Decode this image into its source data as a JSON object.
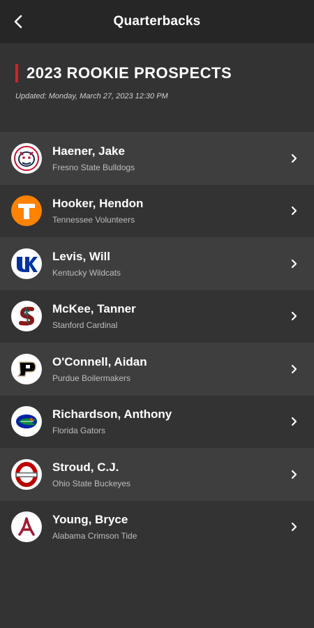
{
  "header": {
    "title": "Quarterbacks"
  },
  "section": {
    "title": "2023 ROOKIE PROSPECTS",
    "updated": "Updated: Monday, March 27, 2023 12:30 PM",
    "accent_color": "#d6202a"
  },
  "players": [
    {
      "name": "Haener, Jake",
      "team": "Fresno State Bulldogs",
      "logo_icon": "fresno-state-bulldog-logo"
    },
    {
      "name": "Hooker, Hendon",
      "team": "Tennessee Volunteers",
      "logo_icon": "tennessee-t-logo"
    },
    {
      "name": "Levis, Will",
      "team": "Kentucky Wildcats",
      "logo_icon": "kentucky-uk-logo"
    },
    {
      "name": "McKee, Tanner",
      "team": "Stanford Cardinal",
      "logo_icon": "stanford-s-tree-logo"
    },
    {
      "name": "O'Connell, Aidan",
      "team": "Purdue Boilermakers",
      "logo_icon": "purdue-p-logo"
    },
    {
      "name": "Richardson, Anthony",
      "team": "Florida Gators",
      "logo_icon": "florida-gator-logo"
    },
    {
      "name": "Stroud, C.J.",
      "team": "Ohio State Buckeyes",
      "logo_icon": "ohio-state-logo"
    },
    {
      "name": "Young, Bryce",
      "team": "Alabama Crimson Tide",
      "logo_icon": "alabama-a-logo"
    }
  ]
}
